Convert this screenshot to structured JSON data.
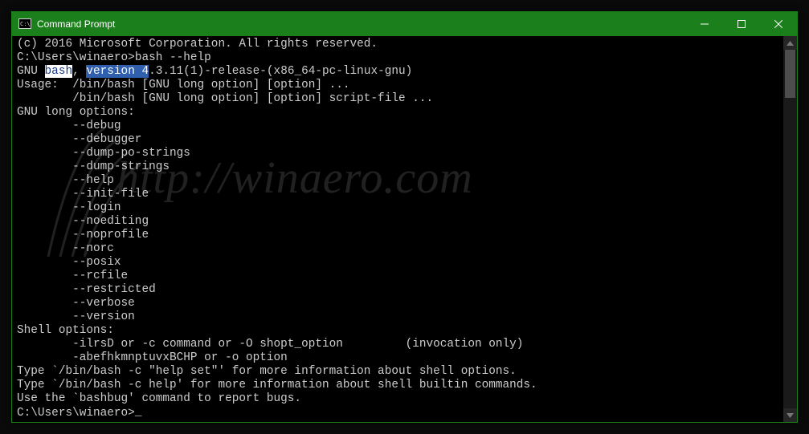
{
  "window": {
    "title": "Command Prompt",
    "accent_color": "#1b7f1b"
  },
  "terminal": {
    "copyright": "(c) 2016 Microsoft Corporation. All rights reserved.",
    "blank": "",
    "prompt1": "C:\\Users\\winaero>",
    "cmd1": "bash --help",
    "version_pre": "GNU ",
    "version_sel1": "bash",
    "version_mid": ", ",
    "version_sel2": "version 4",
    "version_post": ".3.11(1)-release-(x86_64-pc-linux-gnu)",
    "usage1": "Usage:  /bin/bash [GNU long option] [option] ...",
    "usage2": "        /bin/bash [GNU long option] [option] script-file ...",
    "long_opts_hdr": "GNU long options:",
    "opts": [
      "        --debug",
      "        --debugger",
      "        --dump-po-strings",
      "        --dump-strings",
      "        --help",
      "        --init-file",
      "        --login",
      "        --noediting",
      "        --noprofile",
      "        --norc",
      "        --posix",
      "        --rcfile",
      "        --restricted",
      "        --verbose",
      "        --version"
    ],
    "shell_opts_hdr": "Shell options:",
    "shell_opt1": "        -ilrsD or -c command or -O shopt_option         (invocation only)",
    "shell_opt2": "        -abefhkmnptuvxBCHP or -o option",
    "type1": "Type `/bin/bash -c \"help set\"' for more information about shell options.",
    "type2": "Type `/bin/bash -c help' for more information about shell builtin commands.",
    "bugs": "Use the `bashbug' command to report bugs.",
    "prompt2": "C:\\Users\\winaero>",
    "cursor_char": "_"
  },
  "watermark": {
    "text": "http://winaero.com"
  }
}
